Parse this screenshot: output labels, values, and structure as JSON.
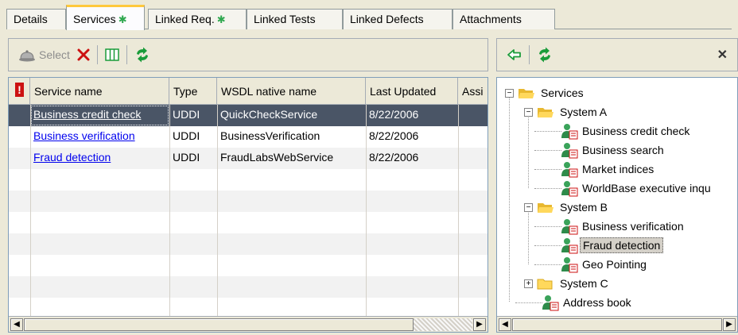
{
  "tabs": [
    {
      "label": "Details",
      "star": false,
      "active": false
    },
    {
      "label": "Services",
      "star": true,
      "active": true
    },
    {
      "label": "Linked Req.",
      "star": true,
      "active": false
    },
    {
      "label": "Linked Tests",
      "star": false,
      "active": false
    },
    {
      "label": "Linked Defects",
      "star": false,
      "active": false
    },
    {
      "label": "Attachments",
      "star": false,
      "active": false
    }
  ],
  "star_glyph": "✱",
  "left_toolbar": {
    "select_label": "Select",
    "icons": [
      "select-bell-icon",
      "delete-icon",
      "columns-icon",
      "refresh-icon"
    ]
  },
  "right_toolbar": {
    "icons": [
      "move-left-icon",
      "refresh-icon",
      "close-icon"
    ],
    "close_glyph": "✕",
    "left_arrow_glyph": "⇦"
  },
  "grid": {
    "flag_header": "!",
    "columns": [
      "Service name",
      "Type",
      "WSDL native name",
      "Last Updated",
      "Assi"
    ],
    "rows": [
      {
        "name": "Business credit check",
        "type": "UDDI",
        "wsdl": "QuickCheckService",
        "updated": "8/22/2006",
        "selected": true
      },
      {
        "name": "Business verification",
        "type": "UDDI",
        "wsdl": "BusinessVerification",
        "updated": "8/22/2006",
        "selected": false
      },
      {
        "name": "Fraud detection",
        "type": "UDDI",
        "wsdl": "FraudLabsWebService",
        "updated": "8/22/2006",
        "selected": false
      }
    ]
  },
  "tree": {
    "root": "Services",
    "nodes": [
      {
        "label": "Services",
        "kind": "folder-open",
        "expander": "−"
      },
      {
        "label": "System A",
        "kind": "folder-open",
        "expander": "−"
      },
      {
        "label": "Business credit check",
        "kind": "service"
      },
      {
        "label": "Business search",
        "kind": "service"
      },
      {
        "label": "Market indices",
        "kind": "service"
      },
      {
        "label": "WorldBase executive inqu",
        "kind": "service"
      },
      {
        "label": "System B",
        "kind": "folder-open",
        "expander": "−"
      },
      {
        "label": "Business verification",
        "kind": "service"
      },
      {
        "label": "Fraud detection",
        "kind": "service",
        "selected": true
      },
      {
        "label": "Geo Pointing",
        "kind": "service"
      },
      {
        "label": "System C",
        "kind": "folder-closed",
        "expander": "+"
      },
      {
        "label": "Address book",
        "kind": "service"
      }
    ]
  },
  "scroll_glyphs": {
    "left": "◀",
    "right": "▶"
  },
  "colors": {
    "accent_tab": "#ffc83c",
    "selected_row": "#4a5566",
    "link": "#0000ee",
    "star": "#2fa84f",
    "delete_red": "#cc1111",
    "refresh_green": "#1a9c3a"
  }
}
